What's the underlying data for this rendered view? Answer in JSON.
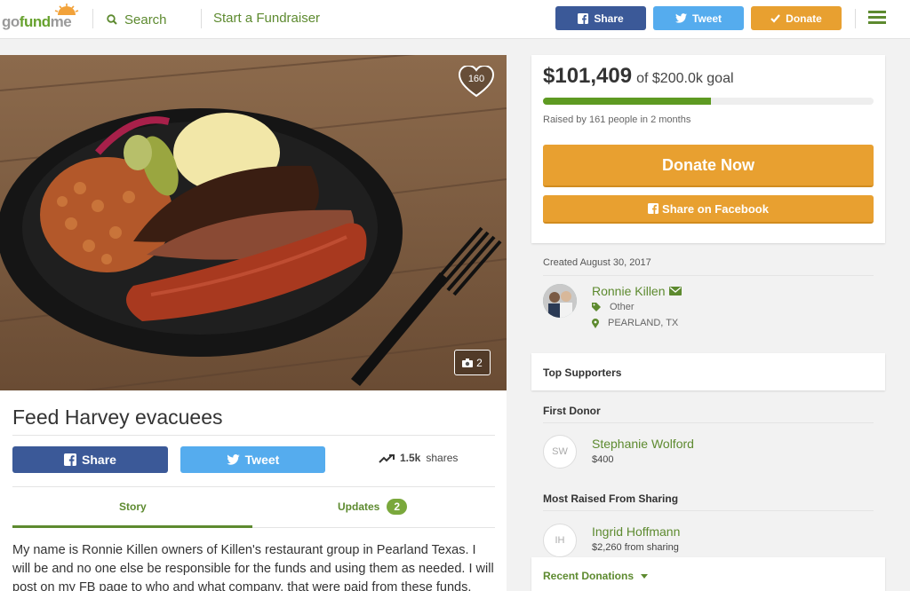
{
  "nav": {
    "logo_go": "go",
    "logo_fund": "fund",
    "logo_me": "me",
    "search_label": "Search",
    "start_label": "Start a Fundraiser",
    "share_label": "Share",
    "tweet_label": "Tweet",
    "donate_label": "Donate"
  },
  "campaign": {
    "title": "Feed Harvey evacuees",
    "hearts": "160",
    "photo_count": "2",
    "share_label": "Share",
    "tweet_label": "Tweet",
    "shares_count": "1.5k",
    "shares_label": "shares",
    "tabs": {
      "story": "Story",
      "updates": "Updates",
      "updates_count": "2"
    },
    "story_text": "My name is Ronnie Killen owners of Killen's restaurant group in Pearland Texas.  I will be and no one else be responsible for the funds and using them as needed. I will post on my FB page to who and what company, that were paid from these funds."
  },
  "donation": {
    "raised": "$101,409",
    "goal": "of $200.0k goal",
    "progress_fraction": 0.507,
    "raised_by": "Raised by 161 people in 2 months",
    "donate_now": "Donate Now",
    "share_facebook": "Share on Facebook"
  },
  "organizer": {
    "created": "Created August 30, 2017",
    "name": "Ronnie Killen",
    "category": "Other",
    "location": "PEARLAND, TX"
  },
  "supporters": {
    "top_title": "Top Supporters",
    "first_donor_title": "First Donor",
    "first_donor": {
      "initials": "SW",
      "name": "Stephanie Wolford",
      "amount": "$400"
    },
    "most_raised_title": "Most Raised From Sharing",
    "most_raised": {
      "initials": "IH",
      "name": "Ingrid Hoffmann",
      "amount": "$2,260 from sharing"
    },
    "recent_label": "Recent Donations"
  },
  "colors": {
    "green": "#5d8a2f",
    "facebook": "#3b5998",
    "twitter": "#55acee",
    "orange": "#e8a030"
  }
}
